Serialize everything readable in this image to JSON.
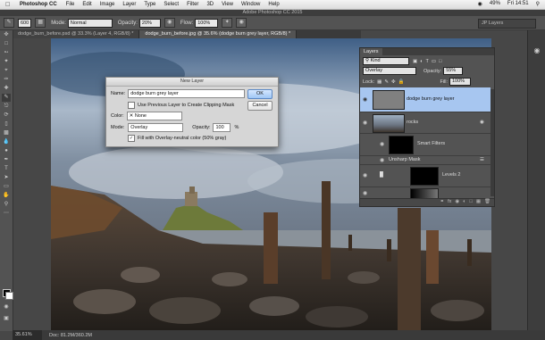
{
  "menubar": {
    "app": "Photoshop CC",
    "items": [
      "File",
      "Edit",
      "Image",
      "Layer",
      "Type",
      "Select",
      "Filter",
      "3D",
      "View",
      "Window",
      "Help"
    ],
    "battery": "49%",
    "clock": "Fri 14:51"
  },
  "window_title": "Adobe Photoshop CC 2015",
  "options": {
    "brush_size": "600",
    "mode_label": "Mode:",
    "mode_value": "Normal",
    "opacity_label": "Opacity:",
    "opacity_value": "20%",
    "flow_label": "Flow:",
    "flow_value": "100%",
    "workspace": "JP Layers"
  },
  "tabs": [
    {
      "label": "dodge_burn_before.psd @ 33.3% (Layer 4, RGB/8) *",
      "active": false
    },
    {
      "label": "dodge_burn_before.jpg @ 35.6% (dodge burn grey layer, RGB/8) *",
      "active": true
    }
  ],
  "status": {
    "zoom": "35.61%",
    "doc": "Doc: 81.2M/360.2M"
  },
  "dialog": {
    "title": "New Layer",
    "name_label": "Name:",
    "name_value": "dodge burn grey layer",
    "clip_label": "Use Previous Layer to Create Clipping Mask",
    "color_label": "Color:",
    "color_value": "None",
    "mode_label": "Mode:",
    "mode_value": "Overlay",
    "opacity_label": "Opacity:",
    "opacity_value": "100",
    "opacity_unit": "%",
    "fill_label": "Fill with Overlay-neutral color (50% gray)",
    "ok": "OK",
    "cancel": "Cancel"
  },
  "layers_panel": {
    "tab": "Layers",
    "kind": "Kind",
    "blend": "Overlay",
    "opacity_label": "Opacity:",
    "opacity_value": "55%",
    "lock_label": "Lock:",
    "fill_label": "Fill:",
    "fill_value": "100%",
    "layers": [
      {
        "name": "dodge burn grey layer",
        "selected": true
      },
      {
        "name": "rocks",
        "selected": false
      },
      {
        "name": "Smart Filters",
        "selected": false
      },
      {
        "name": "Unsharp Mask",
        "selected": false
      },
      {
        "name": "Levels 2",
        "selected": false
      },
      {
        "name": "",
        "selected": false
      }
    ],
    "footer": "fx"
  },
  "colors": {
    "selected_layer": "#a7c6f0",
    "panel_bg": "#535353",
    "dialog_bg": "#d6d6d6"
  }
}
